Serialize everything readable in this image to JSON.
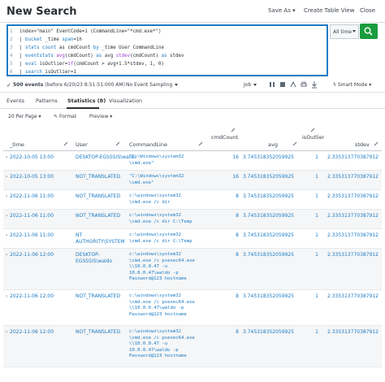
{
  "header": {
    "title": "New Search",
    "save_as": "Save As ▾",
    "create_table_view": "Create Table View",
    "close": "Close"
  },
  "search": {
    "lines": [
      {
        "num": "1",
        "parts": [
          {
            "t": "index=\"main\" EventCode=1 (CommandLine=\"*cmd.exe*\")",
            "c": "tx"
          }
        ]
      },
      {
        "num": "2",
        "parts": [
          {
            "t": "| ",
            "c": "tx"
          },
          {
            "t": "bucket",
            "c": "kw"
          },
          {
            "t": " _time ",
            "c": "tx"
          },
          {
            "t": "span",
            "c": "kw"
          },
          {
            "t": "=1h",
            "c": "tx"
          }
        ]
      },
      {
        "num": "3",
        "parts": [
          {
            "t": "| ",
            "c": "tx"
          },
          {
            "t": "stats count",
            "c": "kw"
          },
          {
            "t": " as cmdCount ",
            "c": "tx"
          },
          {
            "t": "by",
            "c": "kw"
          },
          {
            "t": " _time User CommandLine",
            "c": "tx"
          }
        ]
      },
      {
        "num": "4",
        "parts": [
          {
            "t": "| ",
            "c": "tx"
          },
          {
            "t": "eventstats",
            "c": "kw"
          },
          {
            "t": " ",
            "c": "tx"
          },
          {
            "t": "avg",
            "c": "fn"
          },
          {
            "t": "(cmdCount) ",
            "c": "tx"
          },
          {
            "t": "as",
            "c": "kw"
          },
          {
            "t": " avg ",
            "c": "tx"
          },
          {
            "t": "stdev",
            "c": "fn"
          },
          {
            "t": "(cmdCount) ",
            "c": "tx"
          },
          {
            "t": "as",
            "c": "kw"
          },
          {
            "t": " stdev",
            "c": "tx"
          }
        ]
      },
      {
        "num": "5",
        "parts": [
          {
            "t": "| ",
            "c": "tx"
          },
          {
            "t": "eval",
            "c": "kw"
          },
          {
            "t": " isOutlier=",
            "c": "tx"
          },
          {
            "t": "if",
            "c": "fn"
          },
          {
            "t": "(cmdCount > avg+1.5*stdev, 1, 0)",
            "c": "tx"
          }
        ]
      },
      {
        "num": "6",
        "parts": [
          {
            "t": "| ",
            "c": "tx"
          },
          {
            "t": "search",
            "c": "kw"
          },
          {
            "t": " isOutlier=1",
            "c": "tx"
          }
        ]
      }
    ],
    "time_range": "All time",
    "go_icon": "search-icon"
  },
  "status": {
    "count": "500 events",
    "range": "(before 6/20/23 8:51:51.000 AM)",
    "sampling": "No Event Sampling",
    "job": "Job",
    "smart_mode": "Smart Mode"
  },
  "tabs": [
    {
      "label": "Events",
      "active": false
    },
    {
      "label": "Patterns",
      "active": false
    },
    {
      "label": "Statistics (8)",
      "active": true
    },
    {
      "label": "Visualization",
      "active": false
    }
  ],
  "options": {
    "per_page": "20 Per Page",
    "format": "Format",
    "preview": "Preview"
  },
  "table": {
    "columns": [
      "_time",
      "User",
      "CommandLine",
      "cmdCount",
      "avg",
      "isOutlier",
      "stdev"
    ],
    "rows": [
      {
        "time": "2022-10-05 13:00",
        "user": [
          "DESKTOP-EGSS5IS\\waldo"
        ],
        "cmd": [
          "\"C:\\Windows\\system32",
          "\\cmd.exe\""
        ],
        "count": "16",
        "avg": "3.745318352059925",
        "outlier": "1",
        "stdev": "2.335313770387912"
      },
      {
        "time": "2022-10-05 13:00",
        "user": [
          "NOT_TRANSLATED"
        ],
        "cmd": [
          "\"C:\\Windows\\system32",
          "\\cmd.exe\""
        ],
        "count": "16",
        "avg": "3.745318352059925",
        "outlier": "1",
        "stdev": "2.335313770387912"
      },
      {
        "time": "2022-11-06 11:00",
        "user": [
          "NOT_TRANSLATED"
        ],
        "cmd": [
          "c:\\windows\\system32",
          "\\cmd.exe /c dir"
        ],
        "count": "8",
        "avg": "3.745318352059925",
        "outlier": "1",
        "stdev": "2.335313770387912"
      },
      {
        "time": "2022-11-06 11:00",
        "user": [
          "NOT_TRANSLATED"
        ],
        "cmd": [
          "c:\\windows\\system32",
          "\\cmd.exe /c dir C:\\Temp"
        ],
        "count": "8",
        "avg": "3.745318352059925",
        "outlier": "1",
        "stdev": "2.335313770387912"
      },
      {
        "time": "2022-11-06 11:00",
        "user": [
          "NT",
          "AUTHORITY\\SYSTEM"
        ],
        "cmd": [
          "c:\\windows\\system32",
          "\\cmd.exe /c dir C:\\Temp"
        ],
        "count": "8",
        "avg": "3.745318352059925",
        "outlier": "1",
        "stdev": "2.335313770387912"
      },
      {
        "time": "2022-11-06 12:00",
        "user": [
          "DESKTOP-",
          "EGSS5IS\\waldo"
        ],
        "cmd": [
          "c:\\windows\\system32",
          "\\cmd.exe /c psexec64.exe",
          "\\\\10.0.0.47 -u",
          "10.0.0.47\\waldo -p",
          "Password@123 hostname"
        ],
        "count": "8",
        "avg": "3.745318352059925",
        "outlier": "1",
        "stdev": "2.335313770387912"
      },
      {
        "time": "2022-11-06 12:00",
        "user": [
          "NOT_TRANSLATED"
        ],
        "cmd": [
          "c:\\windows\\system32",
          "\\cmd.exe /c psexec64.exe",
          "\\\\10.0.0.47\\waldo -p",
          "Password@123 hostname"
        ],
        "count": "8",
        "avg": "3.745318352059925",
        "outlier": "1",
        "stdev": "2.335313770387912"
      },
      {
        "time": "2022-11-06 12:00",
        "user": [
          "NOT_TRANSLATED"
        ],
        "cmd": [
          "c:\\windows\\system32",
          "\\cmd.exe /c psexec64.exe",
          "\\\\10.0.0.47 -u",
          "10.0.0.47\\waldo -p",
          "Password@123 hostname"
        ],
        "count": "8",
        "avg": "3.745318352059925",
        "outlier": "1",
        "stdev": "2.335313770387912"
      }
    ]
  },
  "colors": {
    "accent": "#1a7bc6",
    "go_button": "#1a9c3e",
    "search_border": "#1a7bc6"
  }
}
